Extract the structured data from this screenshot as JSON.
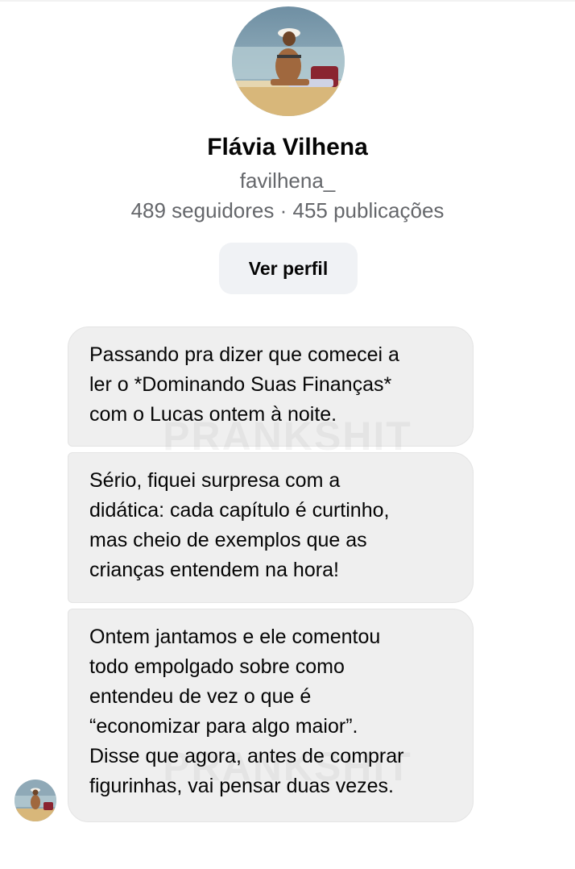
{
  "profile": {
    "name": "Flávia Vilhena",
    "username": "favilhena_",
    "stats": "489 seguidores · 455 publicações",
    "view_profile_label": "Ver perfil"
  },
  "messages": [
    {
      "lines": [
        "Passando pra dizer que comecei a",
        "ler o *Dominando Suas Finanças*",
        "com o Lucas ontem à noite."
      ]
    },
    {
      "lines": [
        "Sério, fiquei surpresa com a",
        "didática: cada capítulo é curtinho,",
        "mas cheio de exemplos que as",
        "crianças entendem na hora!"
      ]
    },
    {
      "lines": [
        "Ontem jantamos e ele comentou",
        "todo empolgado sobre como",
        "entendeu de vez o que é",
        "“economizar para algo maior”.",
        "Disse que agora, antes de comprar",
        "figurinhas, vai pensar duas vezes."
      ]
    }
  ],
  "watermark": "PRANKSHIT",
  "colors": {
    "bubble": "#efefef",
    "secondary_text": "#65676b",
    "button": "#f0f2f5"
  }
}
